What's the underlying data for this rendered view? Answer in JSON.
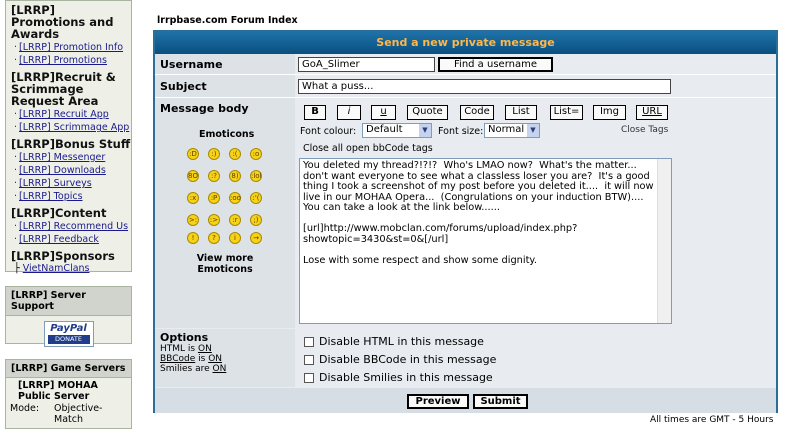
{
  "sidebar": {
    "sections": [
      {
        "title": "[LRRP] Promotions and Awards",
        "links": [
          "[LRRP] Promotion Info",
          "[LRRP] Promotions"
        ]
      },
      {
        "title": "[LRRP]Recruit & Scrimmage Request Area",
        "links": [
          "[LRRP] Recruit App",
          "[LRRP] Scrimmage App"
        ]
      },
      {
        "title": "[LRRP]Bonus Stuff",
        "links": [
          "[LRRP] Messenger",
          "[LRRP] Downloads",
          "[LRRP] Surveys",
          "[LRRP] Topics"
        ]
      },
      {
        "title": "[LRRP]Content",
        "links": [
          "[LRRP] Recommend Us",
          "[LRRP] Feedback"
        ]
      },
      {
        "title": "[LRRP]Sponsors",
        "tree_link": "VietNamClans"
      }
    ],
    "server_support": {
      "title": "[LRRP] Server Support",
      "paypal_logo": "PayPal",
      "paypal_donate": "DONATE"
    },
    "game_servers": {
      "title": "[LRRP] Game Servers",
      "server_name": "[LRRP] MOHAA Public Server",
      "mode_label": "Mode:",
      "mode_value": "Objective-Match"
    }
  },
  "breadcrumb": "lrrpbase.com Forum Index",
  "form": {
    "title": "Send a new private message",
    "username_label": "Username",
    "username_value": "GoA_Slimer",
    "find_button": "Find a username",
    "subject_label": "Subject",
    "subject_value": "What a puss...",
    "body_label": "Message body",
    "emoticons_title": "Emoticons",
    "view_more": "View more Emoticons",
    "bbcode_buttons": [
      "B",
      "i",
      "u",
      "Quote",
      "Code",
      "List",
      "List=",
      "Img",
      "URL"
    ],
    "font_colour_label": "Font colour:",
    "font_colour_value": "Default",
    "font_size_label": "Font size:",
    "font_size_value": "Normal",
    "close_tags": "Close Tags",
    "close_all": "Close all open bbCode tags",
    "message": "You deleted my thread?!?!?  Who's LMAO now?  What's the matter... don't want everyone to see what a classless loser you are?  It's a good thing I took a screenshot of my post before you deleted it....  it will now live in our MOHAA Opera...  (Congrulations on your induction BTW)....  You can take a look at the link below......\n\n[url]http://www.mobclan.com/forums/upload/index.php?showtopic=3430&st=0&[/url]\n\nLose with some respect and show some dignity.",
    "options_label": "Options",
    "html_is": "HTML is",
    "html_state": "ON",
    "bbcode_is_link": "BBCode",
    "bbcode_is": "is",
    "bbcode_state": "ON",
    "smilies_are": "Smilies are",
    "smilies_state": "ON",
    "opt_disable_html": "Disable HTML in this message",
    "opt_disable_bbcode": "Disable BBCode in this message",
    "opt_disable_smilies": "Disable Smilies in this message",
    "preview_button": "Preview",
    "submit_button": "Submit"
  },
  "footer_text": "All times are GMT - 5 Hours"
}
